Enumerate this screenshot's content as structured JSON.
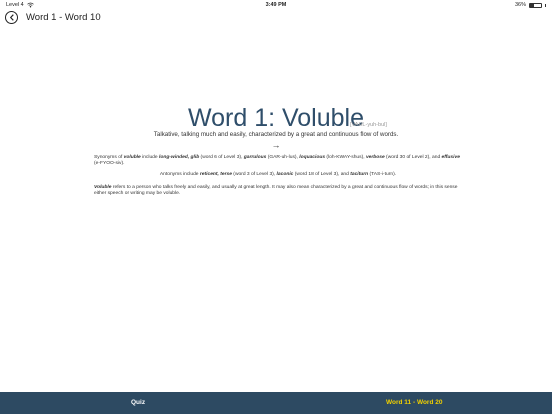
{
  "status": {
    "carrier": "Level 4",
    "time": "3:49 PM",
    "battery": "36%",
    "battery_level": 0.36
  },
  "nav": {
    "title": "Word 1 - Word 10"
  },
  "word": {
    "title": "Word 1: Voluble",
    "pronunciation": "[VAHL-yuh-bul]",
    "definition": "Talkative, talking much and easily, characterized by a great and continuous flow of words.",
    "arrow": "→"
  },
  "synonyms": {
    "t1": "Synonyms of ",
    "t2": "voluble",
    "t3": " include ",
    "t4": "long-winded, glib",
    "t5": " (word 6 of Level 3), ",
    "t6": "garrulous",
    "t7": " (GAR-uh-lus), ",
    "t8": "loquacious",
    "t9": " (loh-KWAY-shus), ",
    "t10": "verbose",
    "t11": " (word 30 of Level 2), and ",
    "t12": "effusive",
    "t13": " (e-FYOO-siv)."
  },
  "antonyms": {
    "t1": "Antonyms include ",
    "t2": "reticent, terse",
    "t3": " (word 3 of Level 3), ",
    "t4": "laconic",
    "t5": " (word 18 of Level 3), and ",
    "t6": "taciturn",
    "t7": " (TAS-i-turn)."
  },
  "usage": {
    "t1": "Voluble",
    "t2": " refers to a person who talks freely and easily, and usually at great length. It may also mean characterized by a great and continuous flow of words; in this sense either speech or writing may be voluble."
  },
  "tabbar": {
    "quiz": "Quiz",
    "next": "Word 11 - Word 20",
    "background": "#2d4a62",
    "next_color": "#f0d000"
  }
}
